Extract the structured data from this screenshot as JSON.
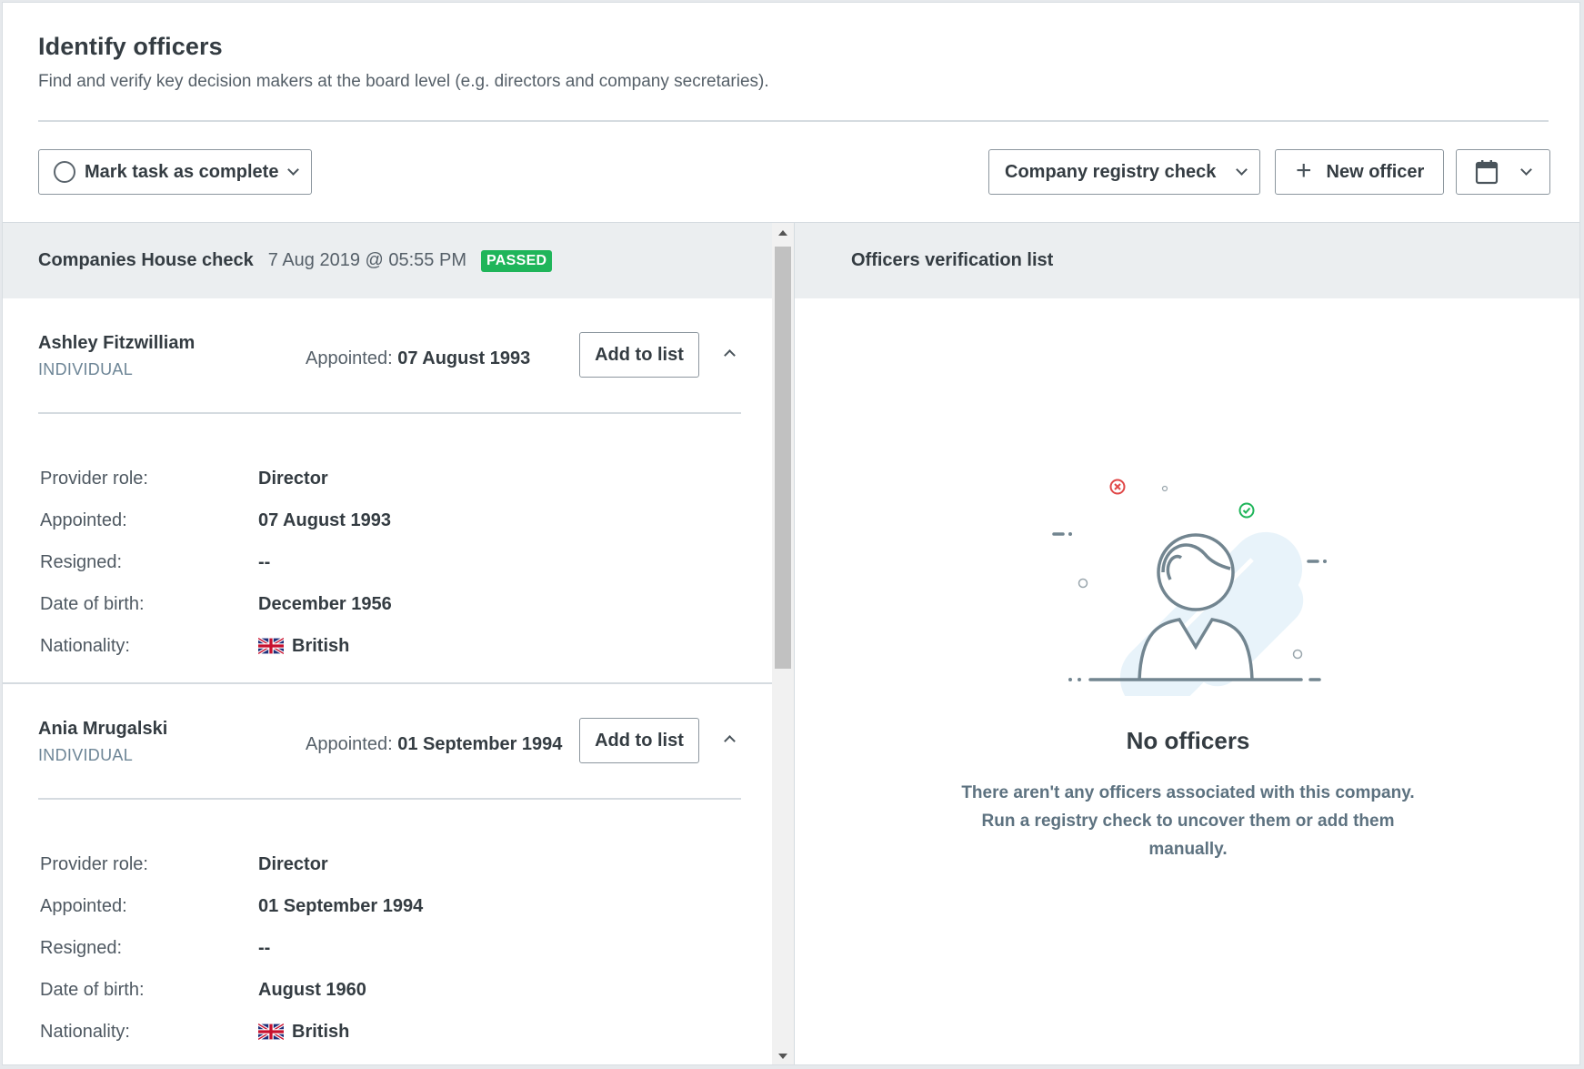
{
  "header": {
    "title": "Identify officers",
    "subtitle": "Find and verify key decision makers at the board level (e.g. directors and company secretaries)."
  },
  "toolbar": {
    "complete_label": "Mark task as complete",
    "registry_label": "Company registry check",
    "new_officer_label": "New officer"
  },
  "check": {
    "title": "Companies House check",
    "date": "7 Aug 2019 @ 05:55 PM",
    "status": "PASSED"
  },
  "labels": {
    "appointed_prefix": "Appointed:",
    "add_to_list": "Add to list",
    "provider_role": "Provider role:",
    "appointed": "Appointed:",
    "resigned": "Resigned:",
    "date_of_birth": "Date of birth:",
    "nationality": "Nationality:"
  },
  "officers": [
    {
      "name": "Ashley Fitzwilliam",
      "type": "INDIVIDUAL",
      "appointed": "07 August 1993",
      "role": "Director",
      "resigned": "--",
      "dob": "December 1956",
      "nationality": "British"
    },
    {
      "name": "Ania Mrugalski",
      "type": "INDIVIDUAL",
      "appointed": "01 September 1994",
      "role": "Director",
      "resigned": "--",
      "dob": "August 1960",
      "nationality": "British"
    }
  ],
  "verification": {
    "title": "Officers verification list",
    "empty_title": "No officers",
    "empty_text": "There aren't any officers associated with this company. Run a registry check to uncover them or add them manually."
  },
  "icons": {
    "complete": "circle-icon",
    "dropdown": "chevron-down-icon",
    "add": "plus-icon",
    "calendar": "calendar-icon",
    "collapse": "chevron-up-icon",
    "nationality": "uk-flag-icon"
  },
  "colors": {
    "passed": "#1fb55a",
    "panel_header": "#ebeef0",
    "illustration_fill": "#e8f3fa",
    "error": "#e04848",
    "success": "#1fb55a"
  }
}
